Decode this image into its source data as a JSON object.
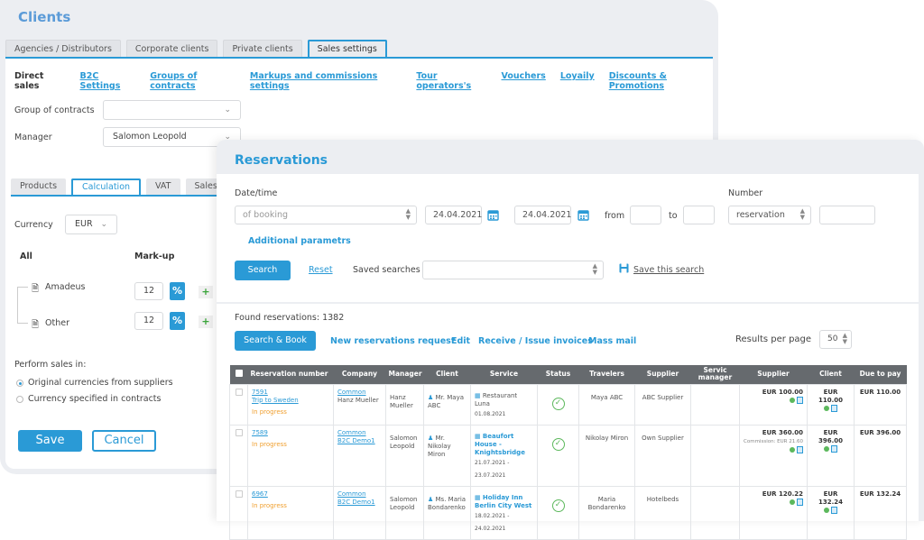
{
  "clients": {
    "title": "Clients",
    "tabs": [
      "Agencies / Distributors",
      "Corporate clients",
      "Private clients",
      "Sales settings"
    ],
    "active_tab": "Sales settings",
    "subnav": {
      "current": "Direct sales",
      "links": [
        "B2C Settings",
        "Groups of contracts",
        "Markups and commissions settings",
        "Tour operators's",
        "Vouchers",
        "Loyaily",
        "Discounts & Promotions"
      ]
    },
    "group_of_contracts": {
      "label": "Group of contracts",
      "value": ""
    },
    "manager": {
      "label": "Manager",
      "value": "Salomon Leopold"
    },
    "tabs2": [
      "Products",
      "Calculation",
      "VAT",
      "Sales te"
    ],
    "active_tab2": "Calculation",
    "currency": {
      "label": "Currency",
      "value": "EUR"
    },
    "markup_table": {
      "col_all": "All",
      "col_markup": "Mark-up",
      "rows": [
        {
          "name": "Amadeus",
          "value": "12",
          "unit": "%"
        },
        {
          "name": "Other",
          "value": "12",
          "unit": "%"
        }
      ],
      "add_label": "+"
    },
    "perform_sales": {
      "label": "Perform sales in:",
      "options": [
        "Original currencies from suppliers",
        "Currency specified in contracts"
      ],
      "selected": 0
    },
    "save_label": "Save",
    "cancel_label": "Cancel"
  },
  "reservations": {
    "title": "Reservations",
    "datetime": {
      "label": "Date/time",
      "type_value": "of booking",
      "from_date": "24.04.2021",
      "to_date": "24.04.2021",
      "from_label": "from",
      "to_label": "to",
      "from_time": "",
      "to_time": ""
    },
    "number": {
      "label": "Number",
      "type_value": "reservation",
      "value": ""
    },
    "additional_params": "Additional parametrs",
    "search_label": "Search",
    "reset_label": "Reset",
    "saved_searches_label": "Saved searches",
    "saved_searches_value": "",
    "save_search_label": "Save this search",
    "found_label": "Found reservations: 1382",
    "actions": {
      "search_book": "Search & Book",
      "new_request": "New reservations request",
      "edit": "Edit",
      "invoices": "Receive / Issue invoices",
      "mass_mail": "Mass mail"
    },
    "results_per_page": {
      "label": "Results per page",
      "value": "50"
    },
    "table": {
      "headers": [
        "Reservation number",
        "Company",
        "Manager",
        "Client",
        "Service",
        "Status",
        "Travelers",
        "Supplier",
        "Servic manager",
        "Supplier",
        "Client",
        "Due to pay"
      ],
      "rows": [
        {
          "number": "7591",
          "trip": "Trip to Sweden",
          "state": "In progress",
          "company": "Common",
          "company2": "Hanz Mueller",
          "company2_link": false,
          "manager": "Hanz Mueller",
          "client": "Mr. Maya ABC",
          "service": "Restaurant Luna",
          "service_bold": false,
          "service_date": "01.08.2021",
          "status": "confirmed",
          "travelers": "Maya ABC",
          "supplier": "ABC Supplier",
          "service_manager": "",
          "supplier_price": "EUR 100.00",
          "commission": "",
          "client_price": "EUR 110.00",
          "due": "EUR 110.00"
        },
        {
          "number": "7589",
          "trip": "",
          "state": "In progress",
          "company": "Common",
          "company2": "B2C Demo1",
          "company2_link": true,
          "manager": "Salomon Leopold",
          "client": "Mr. Nikolay Miron",
          "service": "Beaufort House - Knightsbridge",
          "service_bold": true,
          "service_date": "21.07.2021 - 23.07.2021",
          "status": "confirmed",
          "travelers": "Nikolay Miron",
          "supplier": "Own Supplier",
          "service_manager": "",
          "supplier_price": "EUR 360.00",
          "commission": "Commission: EUR 21.60",
          "client_price": "EUR 396.00",
          "due": "EUR 396.00"
        },
        {
          "number": "6967",
          "trip": "",
          "state": "In progress",
          "company": "Common",
          "company2": "B2C Demo1",
          "company2_link": true,
          "manager": "Salomon Leopold",
          "client": "Ms. Maria Bondarenko",
          "service": "Holiday Inn Berlin City West",
          "service_bold": true,
          "service_date": "18.02.2021 - 24.02.2021",
          "status": "confirmed",
          "travelers": "Maria Bondarenko",
          "supplier": "Hotelbeds",
          "service_manager": "",
          "supplier_price": "EUR 120.22",
          "commission": "",
          "client_price": "EUR 132.24",
          "due": "EUR 132.24"
        }
      ]
    }
  }
}
